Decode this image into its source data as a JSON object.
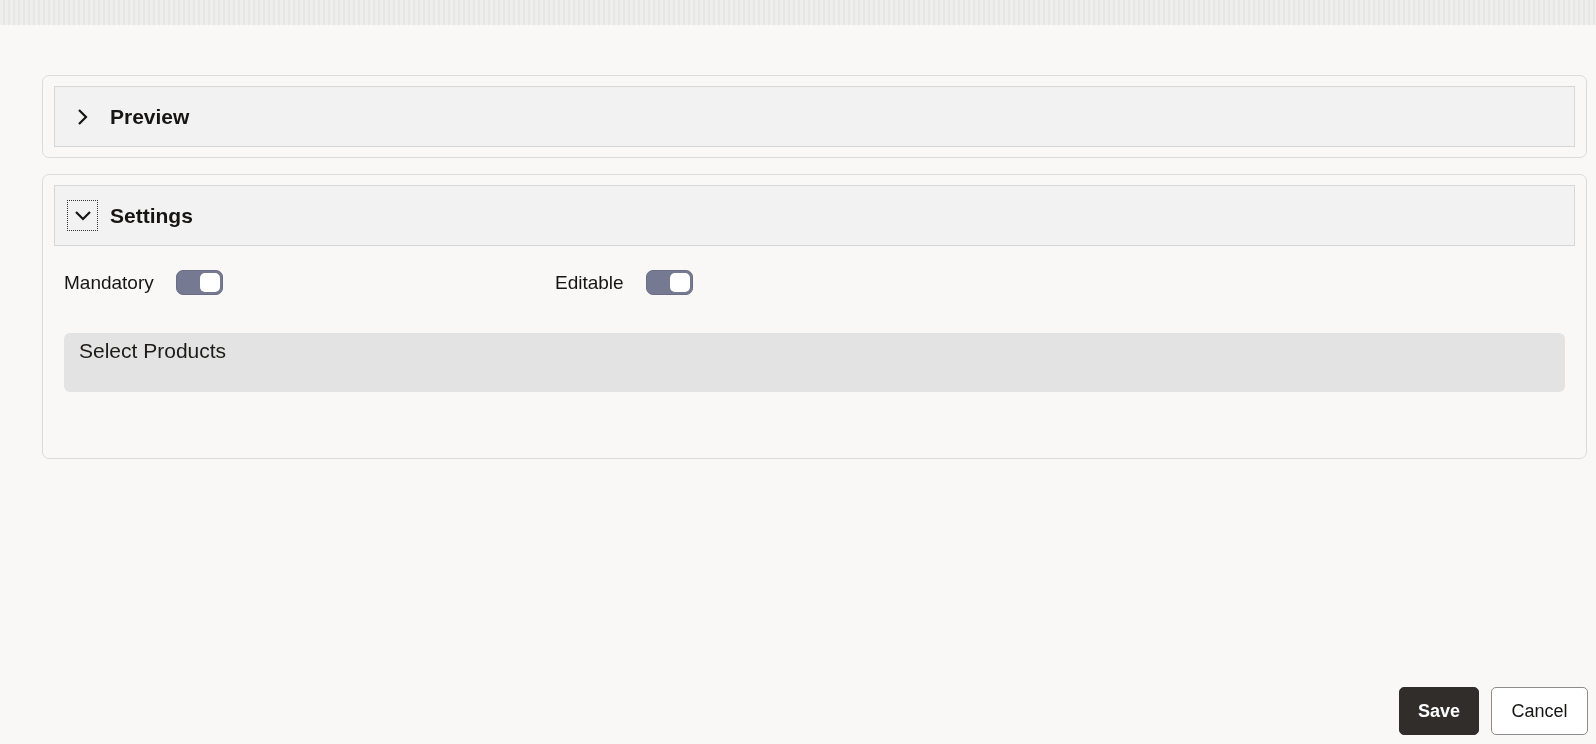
{
  "sections": [
    {
      "title": "Preview",
      "expanded": false,
      "focused": false
    },
    {
      "title": "Settings",
      "expanded": true,
      "focused": true,
      "toggles": [
        {
          "label": "Mandatory",
          "on": true
        },
        {
          "label": "Editable",
          "on": true
        }
      ],
      "products_field": {
        "placeholder": "Select Products"
      }
    }
  ],
  "buttons": [
    {
      "label": "Save",
      "kind": "primary"
    },
    {
      "label": "Cancel",
      "kind": "secondary"
    }
  ]
}
